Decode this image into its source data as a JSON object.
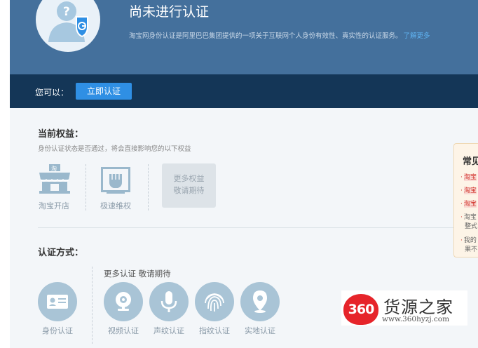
{
  "hero": {
    "title": "尚未进行认证",
    "description": "淘宝网身份认证是阿里巴巴集团提供的一项关于互联网个人身份有效性、真实性的认证服务。",
    "learn_more": "了解更多"
  },
  "action_bar": {
    "you_can": "您可以：",
    "verify_now": "立即认证"
  },
  "benefits": {
    "title": "当前权益：",
    "description": "身份认证状态是否通过，将会直接影响您的以下权益",
    "items": [
      {
        "label": "淘宝开店",
        "icon": "shop-icon"
      },
      {
        "label": "极速维权",
        "icon": "fist-icon"
      }
    ],
    "more_line1": "更多权益",
    "more_line2": "敬请期待"
  },
  "methods": {
    "title": "认证方式：",
    "more_label": "更多认证 敬请期待",
    "items": [
      {
        "label": "身份认证",
        "icon": "id-card-icon"
      },
      {
        "label": "视频认证",
        "icon": "webcam-icon"
      },
      {
        "label": "声纹认证",
        "icon": "microphone-icon"
      },
      {
        "label": "指纹认证",
        "icon": "fingerprint-icon"
      },
      {
        "label": "实地认证",
        "icon": "location-pin-icon"
      }
    ]
  },
  "faq": {
    "title": "常见",
    "items": [
      {
        "text": "淘宝",
        "highlight": true
      },
      {
        "text": "淘宝",
        "highlight": true
      },
      {
        "text": "淘宝",
        "highlight": true
      },
      {
        "text": "淘宝",
        "highlight": false
      },
      {
        "text": "整式",
        "highlight": false
      },
      {
        "text": "我的",
        "highlight": false
      },
      {
        "text": "果不",
        "highlight": false
      }
    ]
  },
  "watermark": {
    "logo_text": "360",
    "site_name": "货源之家",
    "url": "www.360hyzj.com"
  },
  "colors": {
    "hero_bg": "#44709c",
    "action_bar_bg": "#143657",
    "button_blue": "#2f8fe4",
    "icon_blue": "#a9c4d6",
    "link_blue": "#5fb3f2",
    "watermark_red": "#e6242a"
  }
}
